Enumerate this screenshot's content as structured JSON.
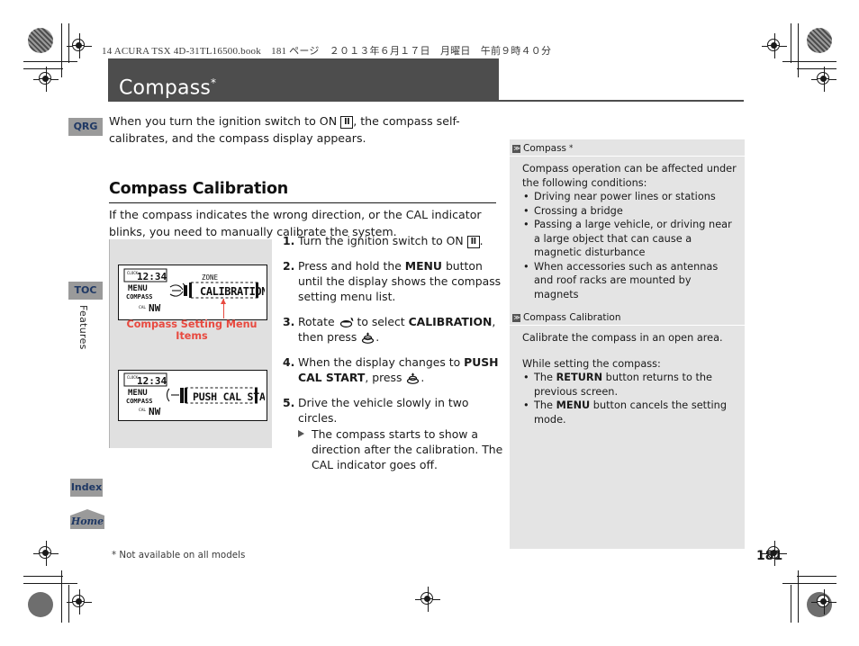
{
  "print_header": {
    "book_line": "14 ACURA TSX 4D-31TL16500.book　181 ページ　２０１３年６月１７日　月曜日　午前９時４０分"
  },
  "title": {
    "text": "Compass",
    "asterisk": "*"
  },
  "sidebar": {
    "qrg_label": "QRG",
    "toc_label": "TOC",
    "index_label": "Index",
    "home_label": "Home",
    "features_label": "Features"
  },
  "main": {
    "intro_before": "When you turn the ignition switch to ON ",
    "intro_key": "II",
    "intro_after": ", the compass self-calibrates, and the compass display appears.",
    "section_heading": "Compass Calibration",
    "section_lead": "If the compass indicates the wrong direction, or the CAL indicator blinks, you need to manually calibrate the system."
  },
  "figures": {
    "lcd1": {
      "time": "12:34",
      "label_menu": "MENU",
      "label_compass": "COMPASS",
      "label_cal": "CAL",
      "label_dir": "NW",
      "label_zone": "ZONE",
      "screen_text": "CALIBRATION"
    },
    "lcd2": {
      "time": "12:34",
      "label_menu": "MENU",
      "label_compass": "COMPASS",
      "label_cal": "CAL",
      "label_dir": "NW",
      "screen_text": "PUSH CAL START"
    },
    "caption": "Compass Setting Menu Items"
  },
  "steps": [
    {
      "num": "1.",
      "parts": [
        {
          "t": "text",
          "v": "Turn the ignition switch to ON "
        },
        {
          "t": "key",
          "v": "II"
        },
        {
          "t": "text",
          "v": "."
        }
      ]
    },
    {
      "num": "2.",
      "parts": [
        {
          "t": "text",
          "v": "Press and hold the "
        },
        {
          "t": "bold",
          "v": "MENU"
        },
        {
          "t": "text",
          "v": " button until the display shows the compass setting menu list."
        }
      ]
    },
    {
      "num": "3.",
      "parts": [
        {
          "t": "text",
          "v": "Rotate "
        },
        {
          "t": "icon",
          "v": "rotate-knob-icon"
        },
        {
          "t": "text",
          "v": " to select "
        },
        {
          "t": "bold",
          "v": "CALIBRATION"
        },
        {
          "t": "text",
          "v": ", then press "
        },
        {
          "t": "icon",
          "v": "press-knob-icon"
        },
        {
          "t": "text",
          "v": "."
        }
      ]
    },
    {
      "num": "4.",
      "parts": [
        {
          "t": "text",
          "v": "When the display changes to "
        },
        {
          "t": "bold",
          "v": "PUSH CAL START"
        },
        {
          "t": "text",
          "v": ", press "
        },
        {
          "t": "icon",
          "v": "press-knob-icon"
        },
        {
          "t": "text",
          "v": "."
        }
      ]
    },
    {
      "num": "5.",
      "parts": [
        {
          "t": "text",
          "v": "Drive the vehicle slowly in two circles."
        }
      ],
      "sub": "The compass starts to show a direction after the calibration. The CAL indicator goes off."
    }
  ],
  "notes": [
    {
      "heading": "Compass",
      "heading_asterisk": "*",
      "intro": "Compass operation can be affected under the following conditions:",
      "bullets": [
        "Driving near power lines or stations",
        "Crossing a bridge",
        "Passing a large vehicle, or driving near a large object that can cause a magnetic disturbance",
        "When accessories such as antennas and roof racks are mounted by magnets"
      ]
    },
    {
      "heading": "Compass Calibration",
      "heading_asterisk": "",
      "intro": "Calibrate the compass in an open area.",
      "intro2": "While setting the compass:",
      "bullets_rich": [
        [
          {
            "t": "text",
            "v": "The "
          },
          {
            "t": "bold",
            "v": "RETURN"
          },
          {
            "t": "text",
            "v": " button returns to the previous screen."
          }
        ],
        [
          {
            "t": "text",
            "v": "The "
          },
          {
            "t": "bold",
            "v": "MENU"
          },
          {
            "t": "text",
            "v": " button cancels the setting mode."
          }
        ]
      ]
    }
  ],
  "footer": {
    "footnote": "* Not available on all models",
    "page_number": "181"
  },
  "colors": {
    "title_bar": "#4d4d4d",
    "tab": "#9a9a9a",
    "tab_text": "#1f3864",
    "notes_bg": "#e4e4e4",
    "figure_bg": "#e0e0e0",
    "caption_red": "#e8493f"
  }
}
